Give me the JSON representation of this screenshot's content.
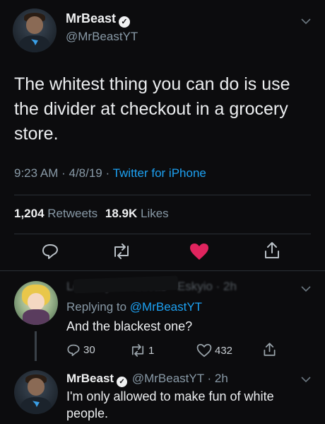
{
  "main_tweet": {
    "author_name": "MrBeast",
    "author_handle": "@MrBeastYT",
    "text_line1": "The whitest thing you can do is use",
    "text_line2": "the divider at checkout in a grocery",
    "text_line3": "store.",
    "time": "9:23 AM",
    "date": "4/8/19",
    "source": "Twitter for iPhone",
    "retweet_count": "1,204",
    "retweet_label": "Retweets",
    "like_count": "18.9K",
    "like_label": "Likes"
  },
  "reply": {
    "author_header_obscured": "Lee Chyko · Lucas · Eskyio · 2h",
    "replying_prefix": "Replying to",
    "replying_handle": "@MrBeastYT",
    "text": "And the blackest one?",
    "reply_count": "30",
    "retweet_count": "1",
    "like_count": "432"
  },
  "second_reply": {
    "author_name": "MrBeast",
    "author_handle": "@MrBeastYT · 2h",
    "text_line1": "I'm only allowed to make fun of white",
    "text_line2": "people."
  },
  "colors": {
    "background": "#0c0c0e",
    "accent": "#1da1f2",
    "like": "#e0245e"
  },
  "icons": [
    "verified-icon",
    "chevron-down-icon",
    "reply-icon",
    "retweet-icon",
    "heart-icon",
    "share-icon"
  ]
}
